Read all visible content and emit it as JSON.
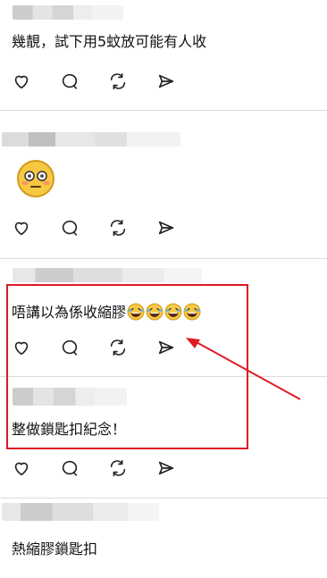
{
  "posts": [
    {
      "text": "幾靚，試下用5蚊放可能有人收"
    },
    {
      "emoji": "flushed-face"
    },
    {
      "text": "唔講以為係收縮膠",
      "emojis": [
        "laughing-face",
        "laughing-face",
        "laughing-face",
        "laughing-face"
      ]
    },
    {
      "text": "整做鎖匙扣紀念！"
    },
    {
      "text": "熱縮膠鎖匙扣"
    }
  ],
  "action_icons": [
    "heart-icon",
    "comment-icon",
    "repost-icon",
    "share-icon"
  ],
  "annotation": {
    "color": "#e01a22"
  }
}
